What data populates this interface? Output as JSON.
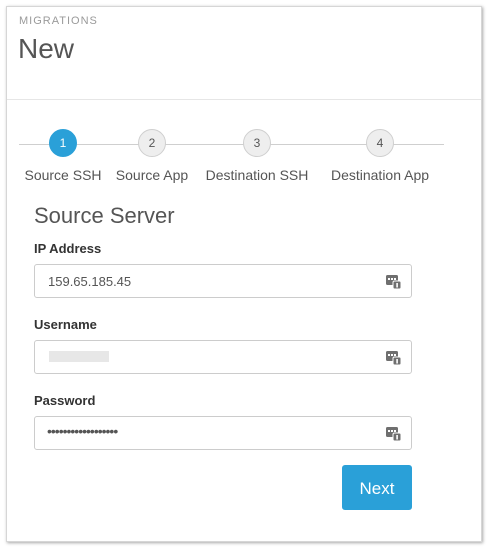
{
  "header": {
    "eyebrow": "MIGRATIONS",
    "title": "New"
  },
  "stepper": {
    "active_step": 1,
    "steps": [
      {
        "number": "1",
        "label": "Source SSH"
      },
      {
        "number": "2",
        "label": "Source App"
      },
      {
        "number": "3",
        "label": "Destination SSH"
      },
      {
        "number": "4",
        "label": "Destination App"
      }
    ]
  },
  "form": {
    "section_title": "Source Server",
    "ip_address": {
      "label": "IP Address",
      "value": "159.65.185.45"
    },
    "username": {
      "label": "Username",
      "value": ""
    },
    "password": {
      "label": "Password",
      "value": "••••••••••••••••••"
    },
    "field_icon": "password-manager-icon"
  },
  "actions": {
    "next_label": "Next"
  },
  "colors": {
    "accent": "#2aa0d8"
  }
}
